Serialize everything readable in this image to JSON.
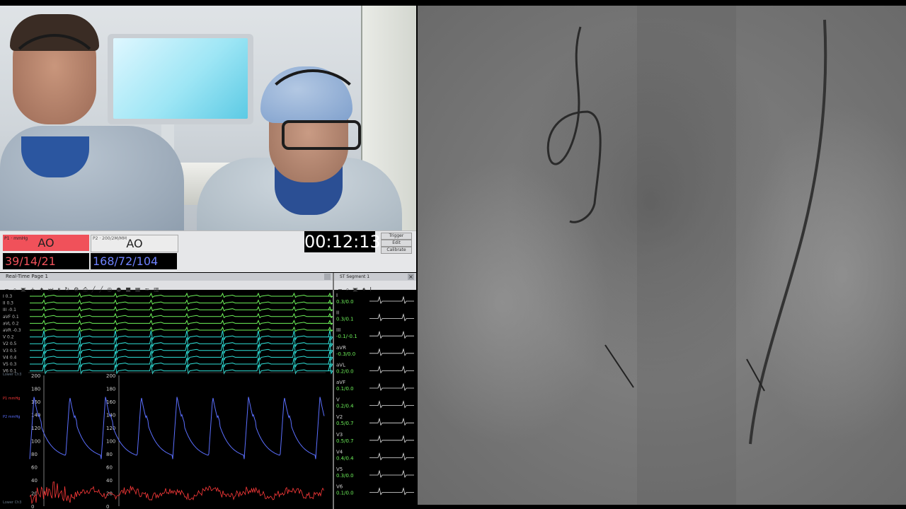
{
  "monitor": {
    "params": [
      {
        "tiny": "P1 · mmHg",
        "label": "AO",
        "value": "39/14/21",
        "color": "#f0515a"
      },
      {
        "tiny": "P2 · 200/2M/MM",
        "label": "AO",
        "value": "168/72/104",
        "color": "#6f82ff"
      }
    ],
    "clock": "00:12:13",
    "side_buttons": [
      "Trigger",
      "Edit",
      "Calibrate"
    ]
  },
  "waveform_panel": {
    "title": "Real-Time Page 1",
    "toolbar_icons": [
      "minus-icon",
      "zoom-icon",
      "save-icon",
      "plus-icon",
      "tool-icon",
      "skip-icon",
      "pause-icon",
      "refresh-icon",
      "settings-icon",
      "print-icon",
      "marker-icon",
      "marker-icon",
      "caliper-icon",
      "record-icon",
      "stop-icon",
      "image-icon",
      "wave-icon",
      "trash-icon"
    ],
    "leads": [
      {
        "name": "I",
        "gain": "0.3"
      },
      {
        "name": "II",
        "gain": "0.3"
      },
      {
        "name": "III",
        "gain": "-0.1"
      },
      {
        "name": "aVF",
        "gain": "0.1"
      },
      {
        "name": "aVL",
        "gain": "0.2"
      },
      {
        "name": "aVR",
        "gain": "-0.3"
      },
      {
        "name": "V",
        "gain": "0.2"
      },
      {
        "name": "V2",
        "gain": "0.5"
      },
      {
        "name": "V3",
        "gain": "0.5"
      },
      {
        "name": "V4",
        "gain": "0.4"
      },
      {
        "name": "V5",
        "gain": "0.3"
      },
      {
        "name": "V6",
        "gain": "0.1"
      }
    ],
    "pressure_axis": [
      "200",
      "180",
      "160",
      "140",
      "120",
      "100",
      "80",
      "60",
      "40",
      "20",
      "0"
    ],
    "pressure_side_labels": [
      "Lower Ch3",
      "P1 mmHg",
      "P2 mmHg",
      "Lower Ch3"
    ]
  },
  "st_panel": {
    "title": "ST Segment 1",
    "toolbar_icons": [
      "minus-icon",
      "zoom-icon",
      "save-icon",
      "tool-icon",
      "text-icon"
    ],
    "leads": [
      {
        "name": "I",
        "value": "0.3/0.0"
      },
      {
        "name": "II",
        "value": "0.3/0.1"
      },
      {
        "name": "III",
        "value": "-0.1/-0.1"
      },
      {
        "name": "aVR",
        "value": "-0.3/0.0"
      },
      {
        "name": "aVL",
        "value": "0.2/0.0"
      },
      {
        "name": "aVF",
        "value": "0.1/0.0"
      },
      {
        "name": "V",
        "value": "0.2/0.4"
      },
      {
        "name": "V2",
        "value": "0.5/0.7"
      },
      {
        "name": "V3",
        "value": "0.5/0.7"
      },
      {
        "name": "V4",
        "value": "0.4/0.4"
      },
      {
        "name": "V5",
        "value": "0.3/0.0"
      },
      {
        "name": "V6",
        "value": "0.1/0.0"
      }
    ]
  },
  "colors": {
    "ecg_green": "#6ef25a",
    "ecg_cyan": "#2fe0d8",
    "pressure_blue": "#5b6fff",
    "pressure_red": "#ff3a3a",
    "axis_white": "#cfcfcf"
  }
}
